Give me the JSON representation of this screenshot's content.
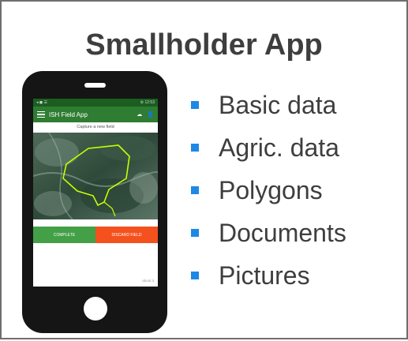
{
  "slide": {
    "title": "Smallholder App"
  },
  "phone": {
    "status_left": "◂ ◼ ☰",
    "status_right": "⚙ 12:53",
    "app_title": "ISH Field App",
    "prompt": "Capture a new field",
    "complete_label": "COMPLETE",
    "discard_label": "DISCARD FIELD",
    "footer": "about it"
  },
  "bullets": [
    {
      "text": "Basic data"
    },
    {
      "text": "Agric. data"
    },
    {
      "text": "Polygons"
    },
    {
      "text": "Documents"
    },
    {
      "text": "Pictures"
    }
  ],
  "colors": {
    "bullet": "#1e88e5",
    "app_bar": "#2e7d32",
    "complete_button": "#43a047",
    "discard_button": "#f4511e",
    "polygon": "#c6ff00"
  }
}
